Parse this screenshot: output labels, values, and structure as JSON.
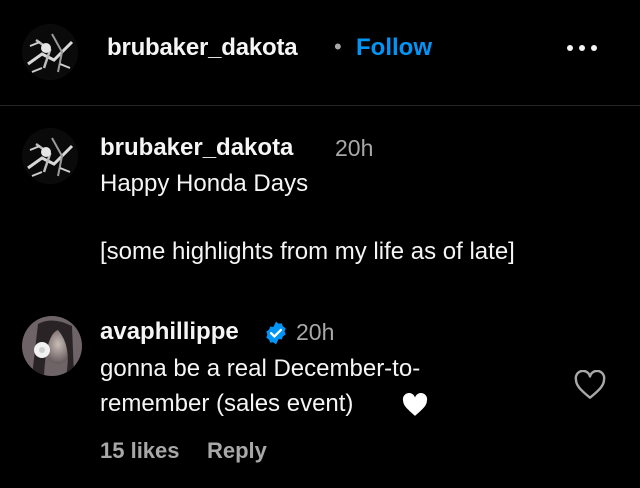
{
  "header": {
    "username": "brubaker_dakota",
    "separator": "•",
    "follow_label": "Follow",
    "more_icon": "more-horizontal-icon"
  },
  "post": {
    "username": "brubaker_dakota",
    "time": "20h",
    "caption_line1": "Happy Honda Days",
    "caption_line2": "[some highlights from my life as of late]"
  },
  "comment": {
    "username": "avaphillippe",
    "verified_icon": "verified-badge-icon",
    "time": "20h",
    "text_line1": "gonna be a real December-to-",
    "text_line2": "remember (sales event)",
    "emoji": "white-heart-icon",
    "likes": "15 likes",
    "reply_label": "Reply",
    "like_icon": "heart-outline-icon"
  },
  "colors": {
    "background": "#000000",
    "text": "#f5f5f5",
    "muted": "#a8a8a8",
    "link": "#0095f6",
    "divider": "#262626"
  }
}
